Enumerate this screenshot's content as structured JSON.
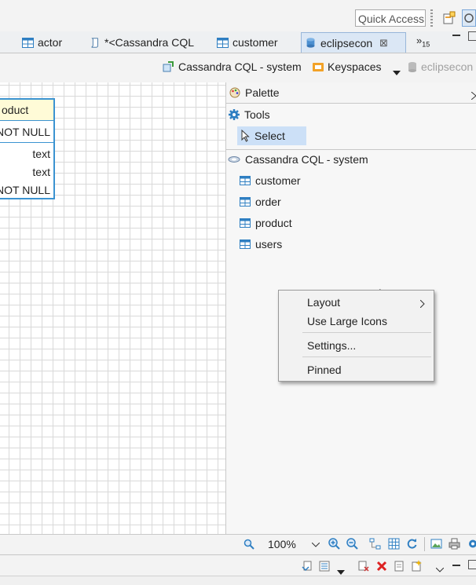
{
  "toolbar": {
    "quick_access": "Quick Access"
  },
  "tabs": [
    {
      "label": "actor",
      "icon": "table-icon"
    },
    {
      "label": "*<Cassandra CQL",
      "icon": "script-icon"
    },
    {
      "label": "customer",
      "icon": "table-icon"
    },
    {
      "label": "eclipsecon",
      "icon": "database-icon",
      "active": true
    }
  ],
  "tabs_overflow": {
    "label": "»",
    "count": "15"
  },
  "editor_toolbar": {
    "connection": "Cassandra CQL - system",
    "keyspaces": "Keyspaces",
    "database": "eclipsecon"
  },
  "entity": {
    "title": "oduct",
    "rows": [
      "NOT NULL",
      "text",
      "text",
      "NOT NULL"
    ]
  },
  "palette": {
    "title": "Palette",
    "tools_label": "Tools",
    "select_label": "Select",
    "connection_label": "Cassandra CQL - system",
    "tables": [
      "customer",
      "order",
      "product",
      "users"
    ]
  },
  "context_menu": {
    "layout": "Layout",
    "large_icons": "Use Large Icons",
    "settings": "Settings...",
    "pinned": "Pinned"
  },
  "zoom": {
    "value": "100%"
  },
  "colors": {
    "accent": "#3b93d1",
    "selection": "#cce0f7",
    "entity_header": "#fffbd7"
  }
}
